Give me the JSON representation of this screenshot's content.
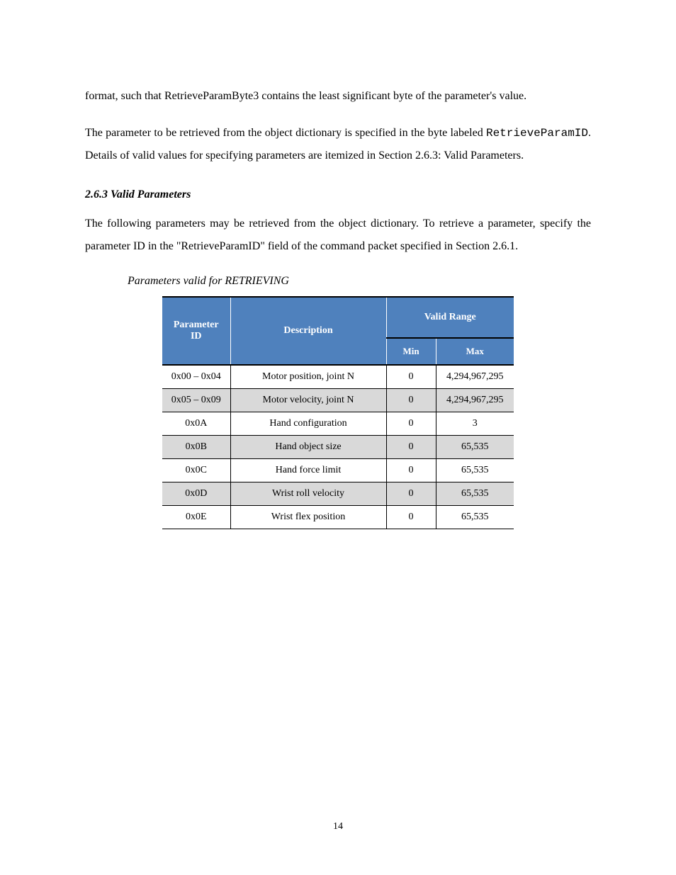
{
  "paragraphs": {
    "p1": "format, such that RetrieveParamByte3 contains the least significant byte of the parameter's value.",
    "p2_part1": "The parameter to be retrieved from the object dictionary is specified in the byte labeled ",
    "p2_code": "RetrieveParamID",
    "p2_part2": ". Details of valid values for specifying parameters are itemized in Section 2.6.3: Valid Parameters."
  },
  "headings": {
    "main": "2.6.3 Valid Parameters",
    "sub": "Parameters valid for RETRIEVING"
  },
  "intro": "The following parameters may be retrieved from the object dictionary. To retrieve a parameter, specify the parameter ID in the \"RetrieveParamID\" field of the command packet specified in Section 2.6.1.",
  "table": {
    "headers": {
      "id": "Parameter ID",
      "desc": "Description",
      "range": "Valid Range",
      "min": "Min",
      "max": "Max"
    },
    "rows": [
      {
        "id": "0x00 – 0x04",
        "desc": "Motor position, joint N",
        "min": "0",
        "max": "4,294,967,295"
      },
      {
        "id": "0x05 – 0x09",
        "desc": "Motor velocity, joint N",
        "min": "0",
        "max": "4,294,967,295"
      },
      {
        "id": "0x0A",
        "desc": "Hand configuration",
        "min": "0",
        "max": "3"
      },
      {
        "id": "0x0B",
        "desc": "Hand object size",
        "min": "0",
        "max": "65,535"
      },
      {
        "id": "0x0C",
        "desc": "Hand force limit",
        "min": "0",
        "max": "65,535"
      },
      {
        "id": "0x0D",
        "desc": "Wrist roll velocity",
        "min": "0",
        "max": "65,535"
      },
      {
        "id": "0x0E",
        "desc": "Wrist flex position",
        "min": "0",
        "max": "65,535"
      }
    ]
  },
  "page_number": "14"
}
